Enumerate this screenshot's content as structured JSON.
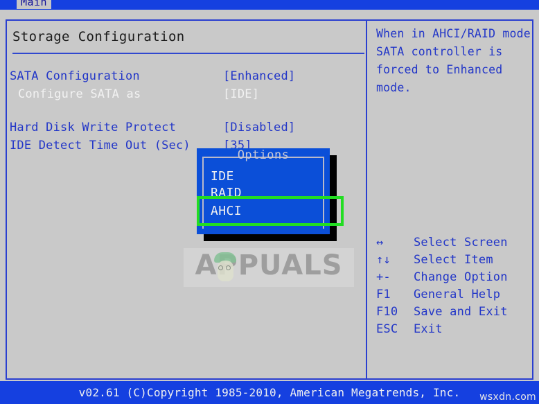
{
  "menubar": {
    "active_tab": "Main"
  },
  "main": {
    "title": "Storage Configuration",
    "settings": [
      {
        "label": "SATA Configuration",
        "value": "[Enhanced]",
        "state": "blue"
      },
      {
        "label": "Configure SATA as",
        "value": "[IDE]",
        "state": "white"
      },
      {
        "label": "Hard Disk Write Protect",
        "value": "[Disabled]",
        "state": "blue"
      },
      {
        "label": "IDE Detect Time Out (Sec)",
        "value": "[35]",
        "state": "blue"
      }
    ]
  },
  "dialog": {
    "title": "Options",
    "options": [
      "IDE",
      "RAID",
      "AHCI"
    ],
    "selected": "IDE",
    "highlighted": "AHCI",
    "highlight_color": "#22dd22"
  },
  "help": {
    "text": "When in AHCI/RAID mode\nSATA controller is\nforced to Enhanced\nmode."
  },
  "legend": {
    "rows": [
      {
        "key": "↔",
        "desc": "Select Screen"
      },
      {
        "key": "↑↓",
        "desc": "Select Item"
      },
      {
        "key": "+-",
        "desc": "Change Option"
      },
      {
        "key": "F1",
        "desc": "General Help"
      },
      {
        "key": "F10",
        "desc": "Save and Exit"
      },
      {
        "key": "ESC",
        "desc": "Exit"
      }
    ]
  },
  "footer": {
    "text": "v02.61 (C)Copyright 1985-2010, American Megatrends, Inc."
  },
  "watermarks": {
    "brand": "APPUALS",
    "site": "wsxdn.com"
  },
  "colors": {
    "background": "#c9c9c9",
    "accent_blue": "#2236c8",
    "bar_blue": "#1540e0",
    "dialog_blue": "#0b4fd8",
    "highlight_green": "#22dd22"
  }
}
